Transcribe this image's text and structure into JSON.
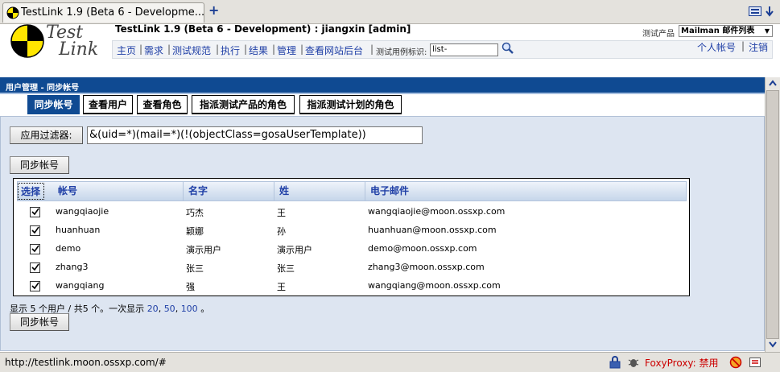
{
  "browser": {
    "tab_title": "TestLink 1.9 (Beta 6 - Developme...",
    "status_url": "http://testlink.moon.ossxp.com/#",
    "proxy_label": "FoxyProxy: 禁用"
  },
  "header": {
    "logo_line1": "Test",
    "logo_line2": "Link",
    "app_title": "TestLink 1.9 (Beta 6 - Development) : jiangxin [admin]",
    "product_label": "测试产品",
    "product_value": "Mailman 邮件列表",
    "testcase_label": "测试用例标识:",
    "testcase_value": "list-",
    "personal_link": "个人帐号",
    "logout_link": "注销",
    "separator": "|",
    "nav": [
      "主页",
      "需求",
      "测试规范",
      "执行",
      "结果",
      "管理",
      "查看网站后台"
    ]
  },
  "page": {
    "title": "用户管理 - 同步帐号",
    "subtabs": [
      "同步帐号",
      "查看用户",
      "查看角色",
      "指派测试产品的角色",
      "指派测试计划的角色"
    ],
    "filter_button": "应用过滤器:",
    "filter_value": "&(uid=*)(mail=*)(!(objectClass=gosaUserTemplate))",
    "sync_button": "同步帐号",
    "columns": [
      "选择",
      "帐号",
      "名字",
      "姓",
      "电子邮件"
    ],
    "rows": [
      {
        "account": "wangqiaojie",
        "first": "巧杰",
        "last": "王",
        "email": "wangqiaojie@moon.ossxp.com",
        "checked": true
      },
      {
        "account": "huanhuan",
        "first": "颖娜",
        "last": "孙",
        "email": "huanhuan@moon.ossxp.com",
        "checked": true
      },
      {
        "account": "demo",
        "first": "演示用户",
        "last": "演示用户",
        "email": "demo@moon.ossxp.com",
        "checked": true
      },
      {
        "account": "zhang3",
        "first": "张三",
        "last": "张三",
        "email": "zhang3@moon.ossxp.com",
        "checked": true
      },
      {
        "account": "wangqiang",
        "first": "强",
        "last": "王",
        "email": "wangqiang@moon.ossxp.com",
        "checked": true
      }
    ],
    "summary_prefix": "显示 5 个用户 / 共5 个。一次显示",
    "page_sizes": [
      "20",
      "50",
      "100"
    ],
    "summary_suffix": "。"
  },
  "colors": {
    "title_bar": "#0f4a92",
    "link": "#1f3fa6",
    "content_bg": "#dde5f1"
  }
}
